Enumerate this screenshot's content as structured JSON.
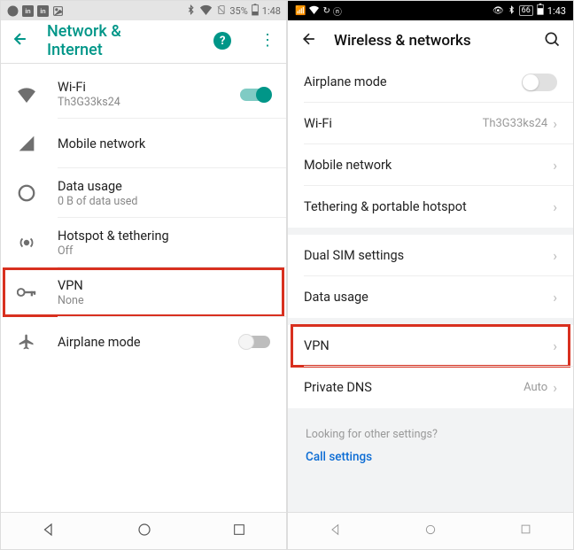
{
  "left": {
    "status": {
      "battery": "35%",
      "time": "1:48"
    },
    "appbar": {
      "title": "Network & Internet"
    },
    "items": [
      {
        "title": "Wi-Fi",
        "sub": "Th3G33ks24"
      },
      {
        "title": "Mobile network",
        "sub": ""
      },
      {
        "title": "Data usage",
        "sub": "0 B of data used"
      },
      {
        "title": "Hotspot & tethering",
        "sub": "Off"
      },
      {
        "title": "VPN",
        "sub": "None"
      },
      {
        "title": "Airplane mode",
        "sub": ""
      }
    ]
  },
  "right": {
    "status": {
      "battery": "66",
      "time": "1:43"
    },
    "appbar": {
      "title": "Wireless & networks"
    },
    "g1": [
      {
        "title": "Airplane mode",
        "val": ""
      },
      {
        "title": "Wi-Fi",
        "val": "Th3G33ks24"
      },
      {
        "title": "Mobile network",
        "val": ""
      },
      {
        "title": "Tethering & portable hotspot",
        "val": ""
      }
    ],
    "g2": [
      {
        "title": "Dual SIM settings",
        "val": ""
      },
      {
        "title": "Data usage",
        "val": ""
      }
    ],
    "g3": [
      {
        "title": "VPN",
        "val": ""
      },
      {
        "title": "Private DNS",
        "val": "Auto"
      }
    ],
    "more": {
      "q": "Looking for other settings?",
      "link": "Call settings"
    }
  }
}
